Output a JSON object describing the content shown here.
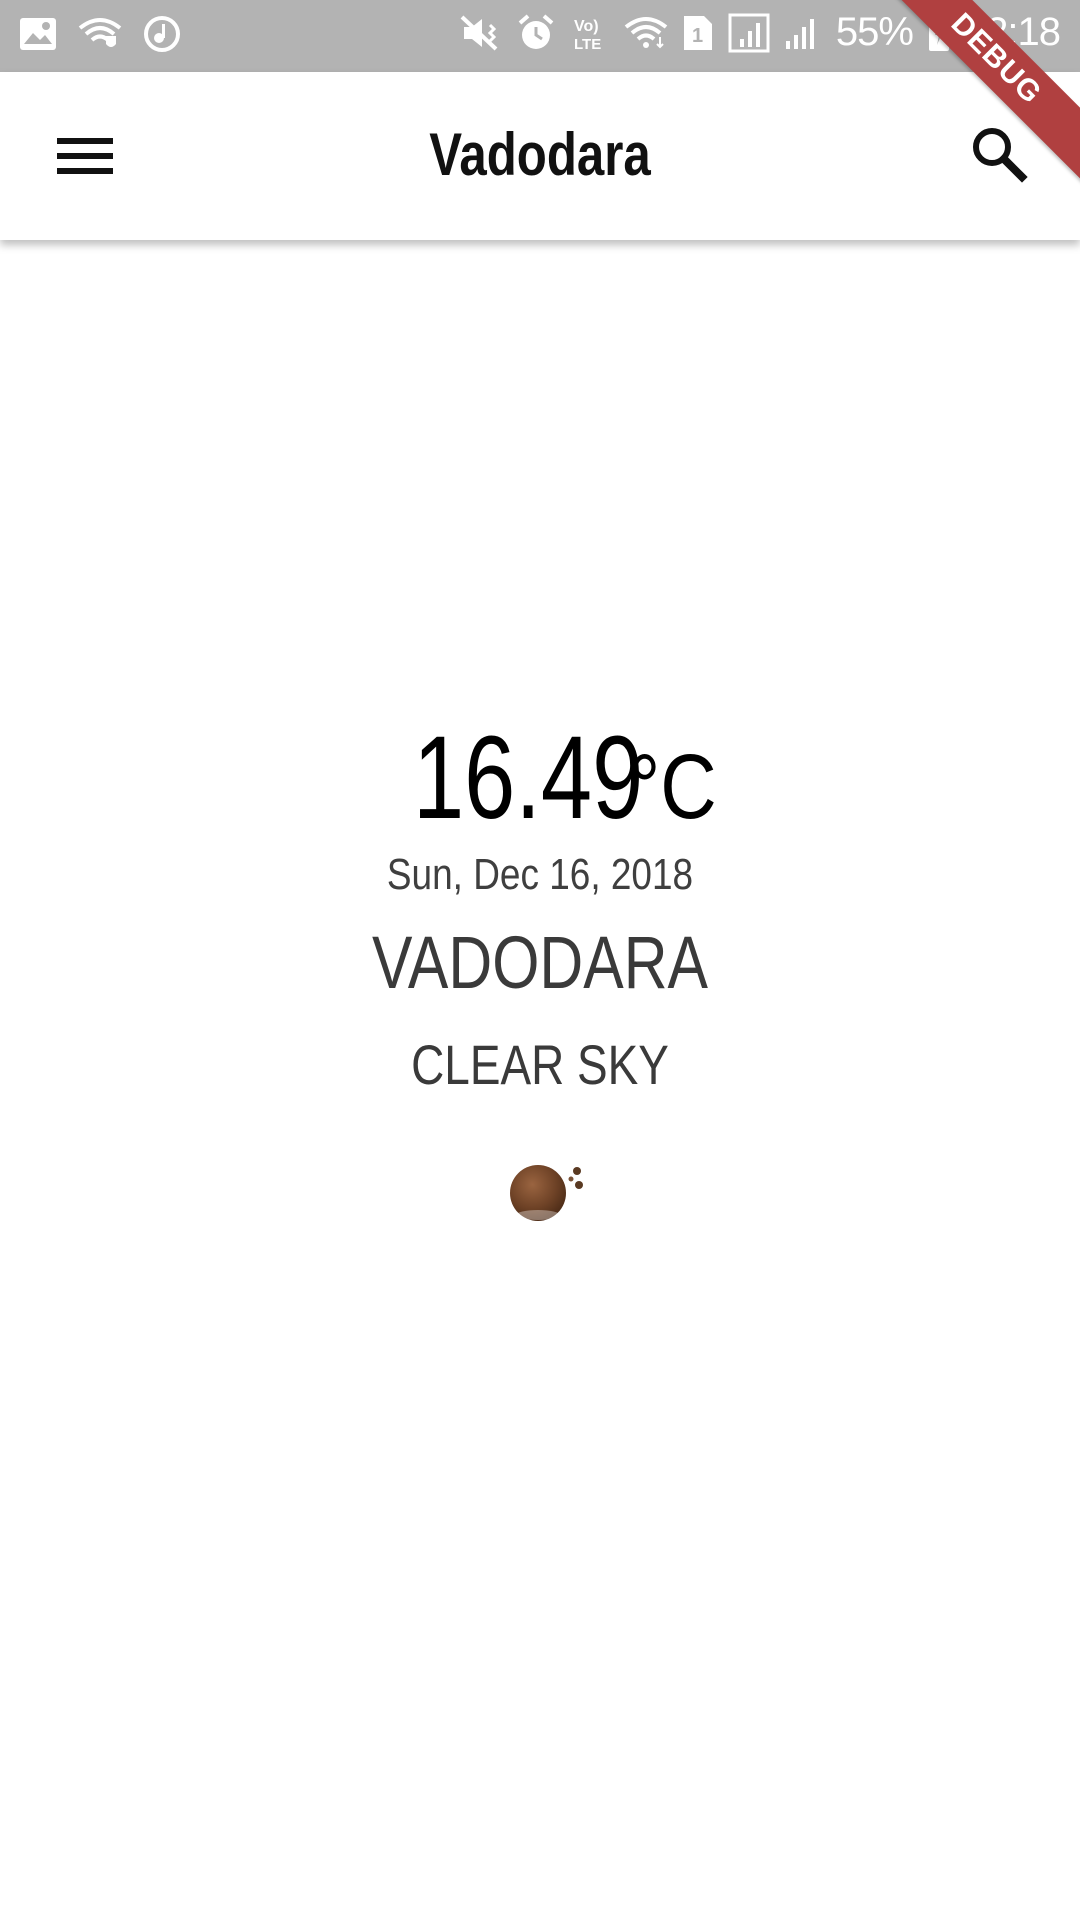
{
  "status_bar": {
    "battery": "55%",
    "time": "02:18",
    "sim_slot": "1",
    "volte": "Vo) LTE"
  },
  "app_bar": {
    "title": "Vadodara"
  },
  "debug_banner": {
    "label": "DEBUG"
  },
  "weather": {
    "temperature": "16.49",
    "unit": "°C",
    "date": "Sun, Dec 16, 2018",
    "city": "VADODARA",
    "condition": "CLEAR SKY",
    "icon": "clear-sky-night-icon"
  },
  "colors": {
    "status_bar_bg": "#b3b3b3",
    "app_bar_bg": "#ffffff",
    "debug_ribbon": "#b04040",
    "icon_brown": "#7a4a2a"
  }
}
